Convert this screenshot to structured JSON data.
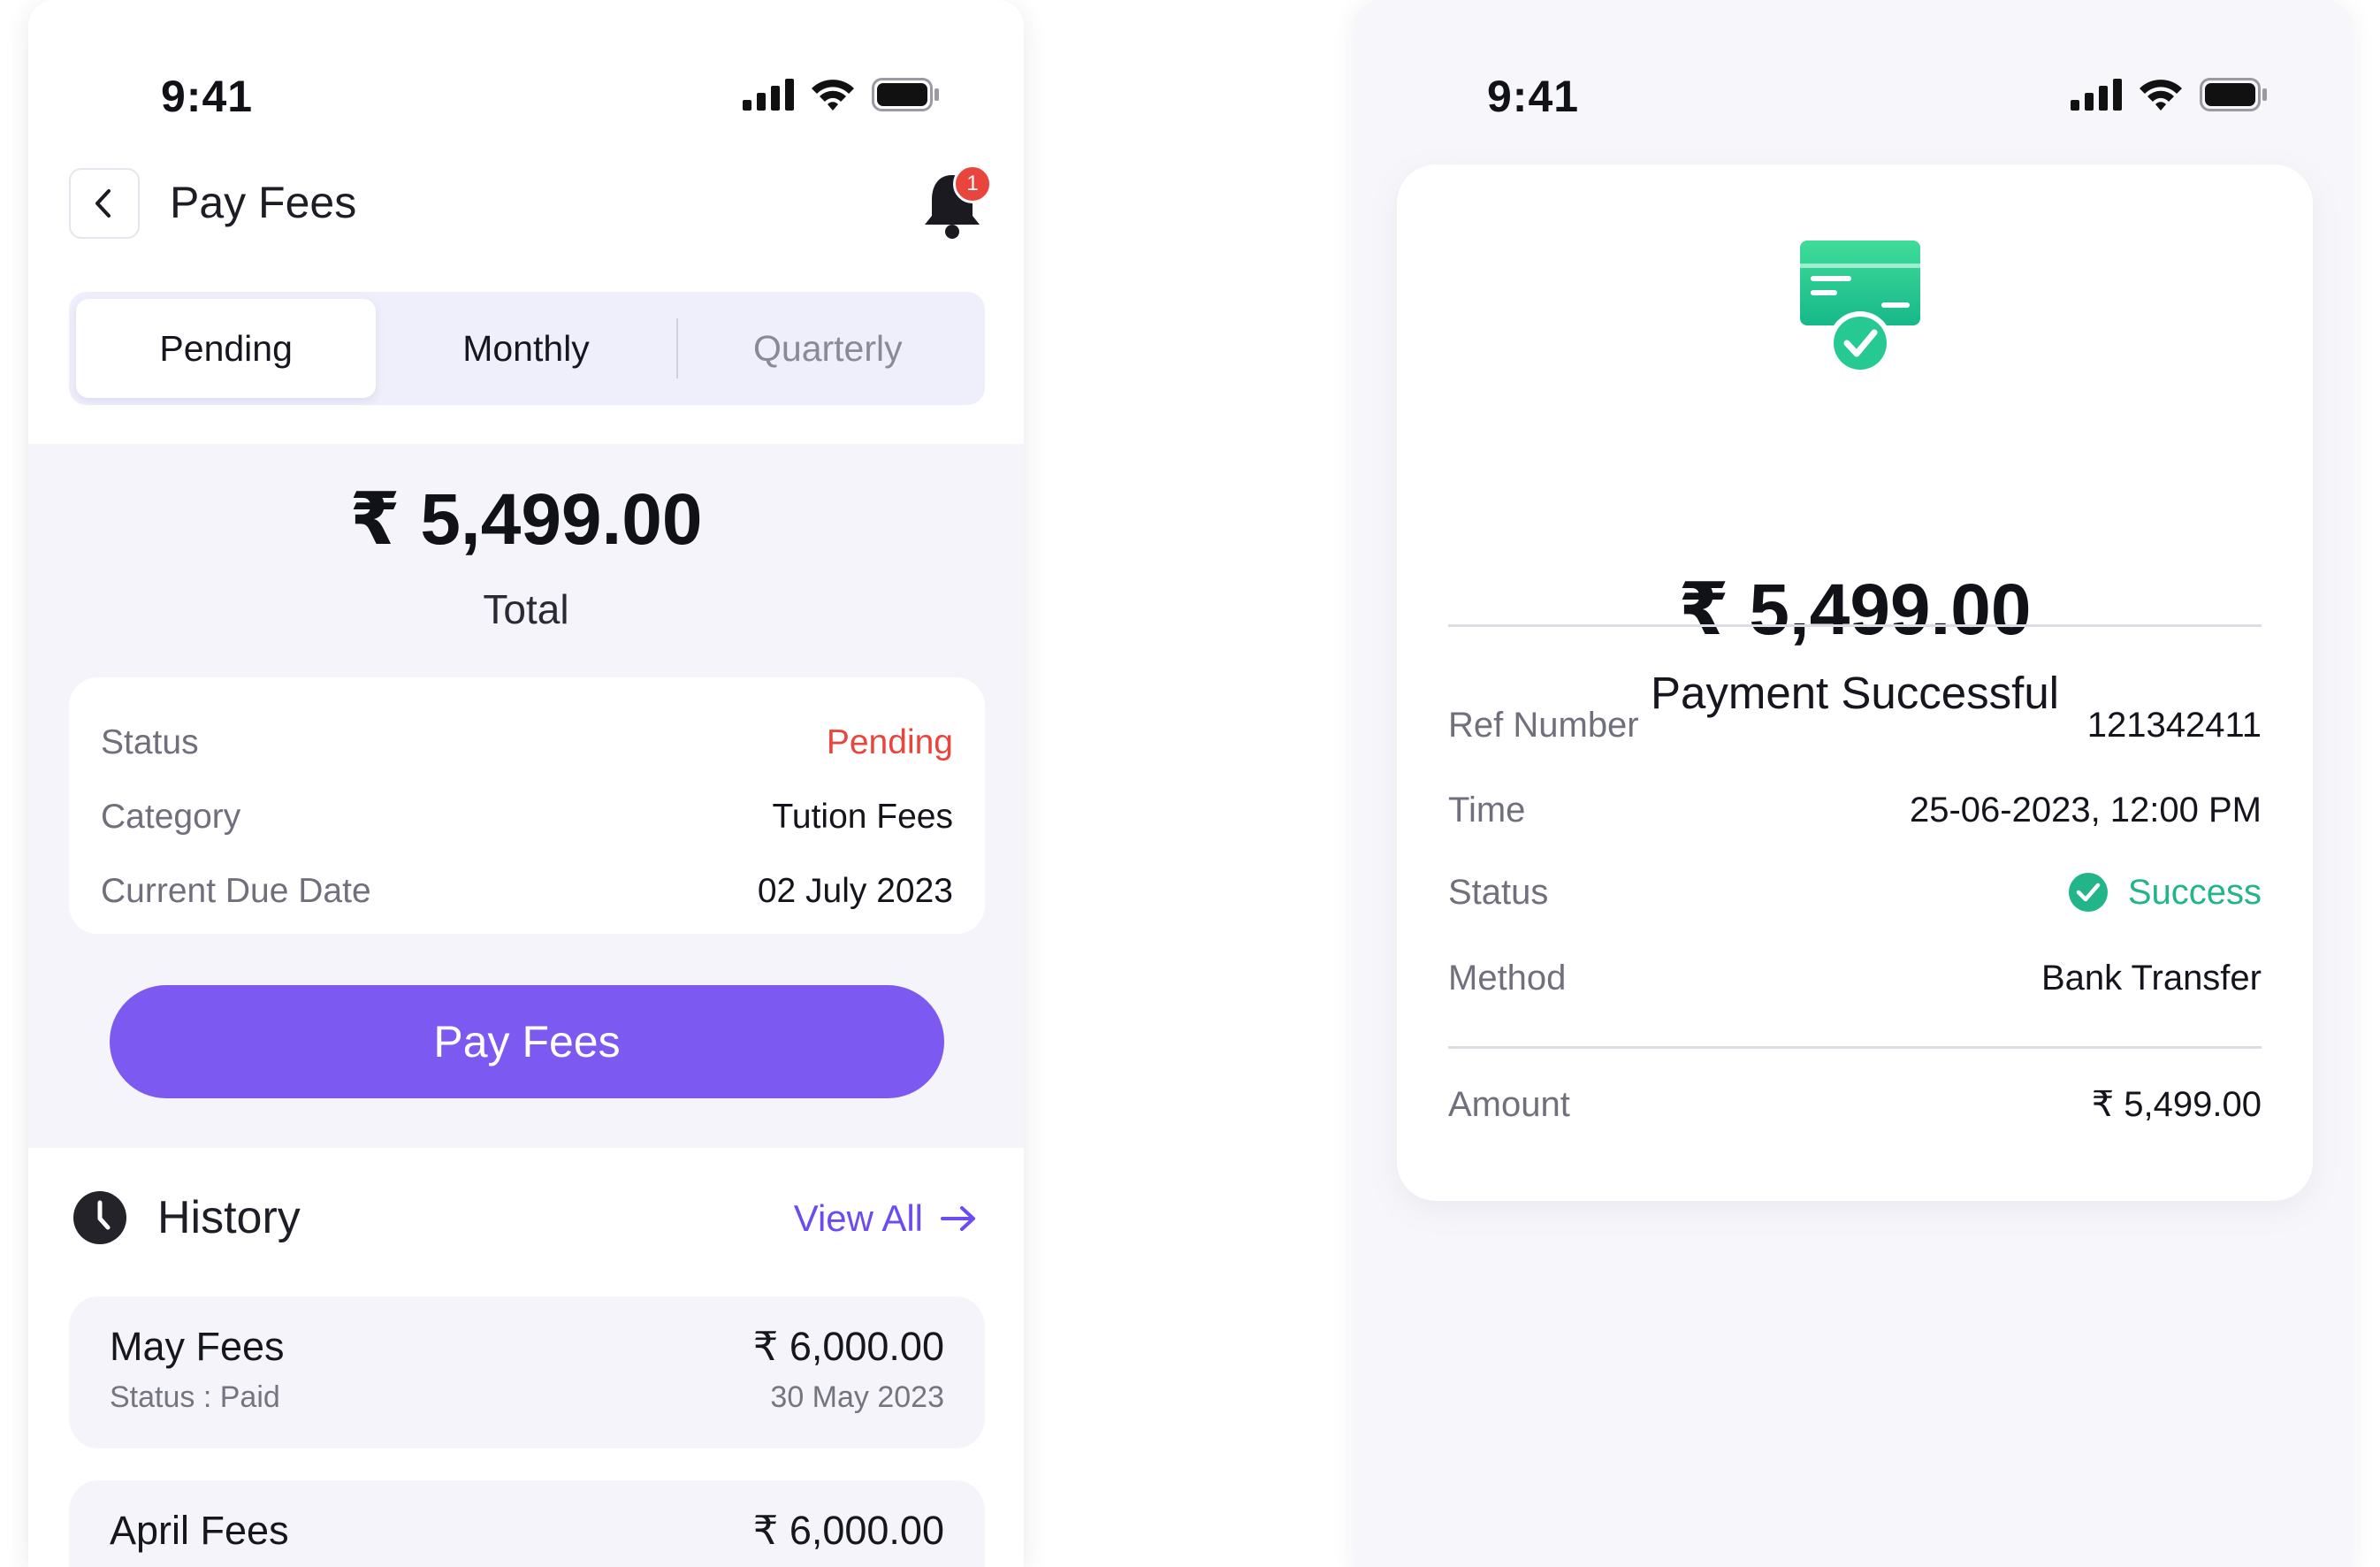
{
  "left_screen": {
    "status_bar": {
      "time": "9:41"
    },
    "header": {
      "title": "Pay Fees",
      "notification_count": "1"
    },
    "tabs": [
      {
        "label": "Pending",
        "active": true
      },
      {
        "label": "Monthly",
        "active": false
      },
      {
        "label": "Quarterly",
        "active": false
      }
    ],
    "summary": {
      "amount": "₹ 5,499.00",
      "label": "Total"
    },
    "details": [
      {
        "label": "Status",
        "value": "Pending"
      },
      {
        "label": "Category",
        "value": "Tution Fees"
      },
      {
        "label": "Current Due Date",
        "value": "02 July 2023"
      }
    ],
    "pay_button_label": "Pay Fees",
    "history": {
      "title": "History",
      "view_all_label": "View All",
      "items": [
        {
          "name": "May Fees",
          "status": "Status : Paid",
          "amount": "₹ 6,000.00",
          "date": "30 May 2023"
        },
        {
          "name": "April Fees",
          "amount": "₹ 6,000.00"
        }
      ]
    }
  },
  "right_screen": {
    "status_bar": {
      "time": "9:41"
    },
    "receipt": {
      "amount": "₹ 5,499.00",
      "title": "Payment Successful",
      "rows": [
        {
          "label": "Ref Number",
          "value": "121342411"
        },
        {
          "label": "Time",
          "value": "25-06-2023, 12:00 PM"
        },
        {
          "label": "Status",
          "value": "Success"
        },
        {
          "label": "Method",
          "value": "Bank Transfer"
        }
      ],
      "amount_row": {
        "label": "Amount",
        "value": "₹ 5,499.00"
      }
    }
  },
  "colors": {
    "accent": "#7c59f0",
    "pending": "#e8453c",
    "success": "#22b58a",
    "badge": "#e8453c"
  },
  "icons": [
    "signal-icon",
    "wifi-icon",
    "battery-icon",
    "back-chevron-icon",
    "bell-icon",
    "clock-icon",
    "arrow-right-icon",
    "card-check-icon",
    "check-circle-icon"
  ]
}
